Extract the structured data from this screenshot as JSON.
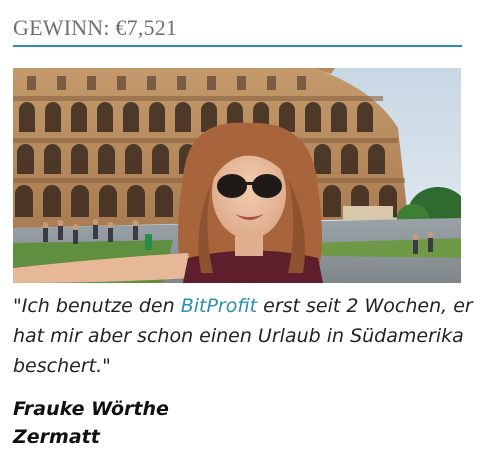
{
  "heading": {
    "label": "GEWINN:",
    "amount": "€7,521"
  },
  "colors": {
    "accent": "#2a8fb3",
    "heading_text": "#6f6f6f"
  },
  "photo": {
    "alt": "Frau macht ein Selfie vor dem Kolosseum"
  },
  "testimonial": {
    "open_quote": "\"",
    "text_before": "Ich benutze den ",
    "link_text": "BitProfit",
    "text_after": " erst seit 2 Wochen, er hat mir aber schon einen Urlaub in Südamerika beschert.",
    "close_quote": "\""
  },
  "author": {
    "name": "Frauke Wörthe",
    "city": "Zermatt"
  }
}
